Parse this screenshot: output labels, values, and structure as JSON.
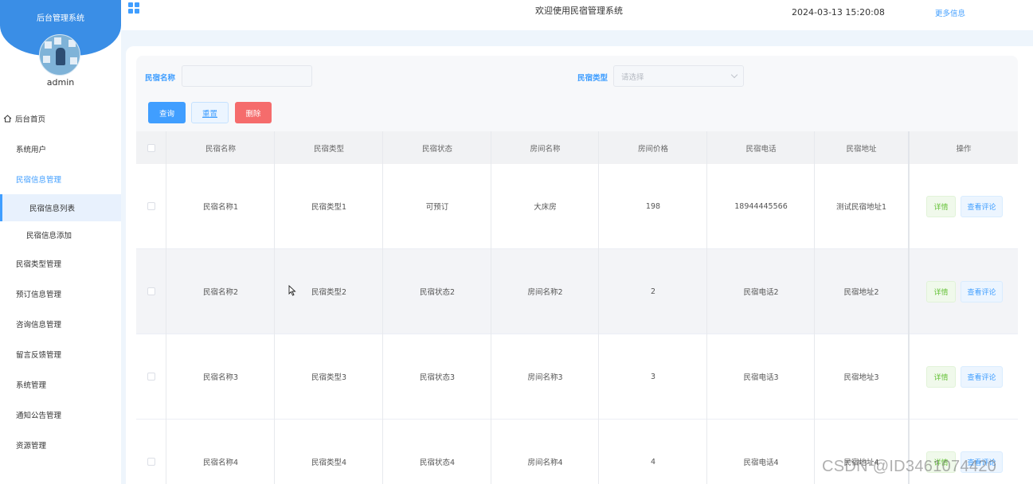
{
  "sidebar": {
    "brand_title": "后台管理系统",
    "user_name": "admin",
    "home_label": "后台首页",
    "items": [
      {
        "label": "系统用户"
      },
      {
        "label": "民宿信息管理"
      },
      {
        "label": "民宿类型管理"
      },
      {
        "label": "预订信息管理"
      },
      {
        "label": "咨询信息管理"
      },
      {
        "label": "留言反馈管理"
      },
      {
        "label": "系统管理"
      },
      {
        "label": "通知公告管理"
      },
      {
        "label": "资源管理"
      }
    ],
    "sub_items": [
      {
        "label": "民宿信息列表",
        "active": true
      },
      {
        "label": "民宿信息添加",
        "active": false
      }
    ]
  },
  "header": {
    "title": "欢迎使用民宿管理系统",
    "datetime": "2024-03-13 15:20:08",
    "more": "更多信息"
  },
  "search": {
    "name_label": "民宿名称",
    "name_value": "",
    "type_label": "民宿类型",
    "type_placeholder": "请选择"
  },
  "buttons": {
    "query": "查询",
    "reset": "重置",
    "delete": "删除"
  },
  "table": {
    "headers": [
      "民宿名称",
      "民宿类型",
      "民宿状态",
      "房间名称",
      "房间价格",
      "民宿电话",
      "民宿地址",
      "操作"
    ],
    "rows": [
      [
        "民宿名称1",
        "民宿类型1",
        "可预订",
        "大床房",
        "198",
        "18944445566",
        "测试民宿地址1"
      ],
      [
        "民宿名称2",
        "民宿类型2",
        "民宿状态2",
        "房间名称2",
        "2",
        "民宿电话2",
        "民宿地址2"
      ],
      [
        "民宿名称3",
        "民宿类型3",
        "民宿状态3",
        "房间名称3",
        "3",
        "民宿电话3",
        "民宿地址3"
      ],
      [
        "民宿名称4",
        "民宿类型4",
        "民宿状态4",
        "房间名称4",
        "4",
        "民宿电话4",
        "民宿地址4"
      ]
    ],
    "detail_label": "详情",
    "review_label": "查看评论"
  },
  "watermark": "CSDN @ID3461074420",
  "colors": {
    "primary": "#409eff",
    "brand": "#3a8ee6",
    "danger": "#f56c6c",
    "success": "#67c23a"
  }
}
